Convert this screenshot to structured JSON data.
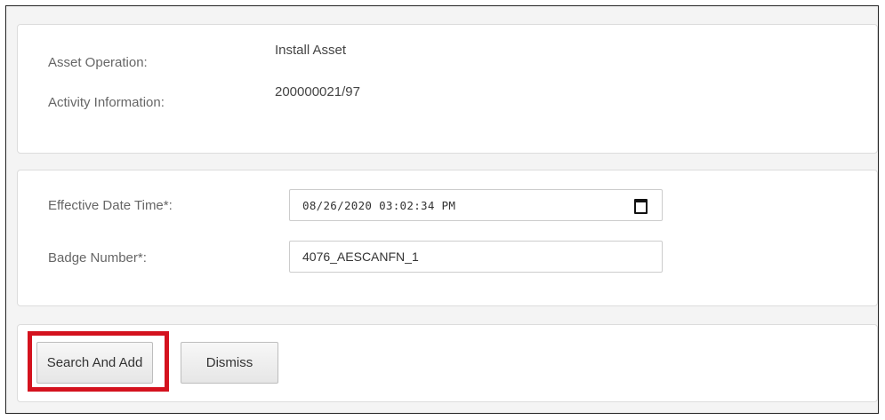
{
  "info": {
    "asset_operation_label": "Asset Operation:",
    "asset_operation_value": "Install Asset",
    "activity_info_label": "Activity Information:",
    "activity_info_value": "200000021/97"
  },
  "form": {
    "effective_date_label": "Effective Date Time*:",
    "effective_date_value": "08/26/2020 03:02:34 PM",
    "badge_number_label": "Badge Number*:",
    "badge_number_value": "4076_AESCANFN_1"
  },
  "actions": {
    "search_and_add_label": "Search And Add",
    "dismiss_label": "Dismiss"
  },
  "icons": {
    "date_picker": "calendar-icon"
  },
  "colors": {
    "highlight": "#d4121e"
  }
}
